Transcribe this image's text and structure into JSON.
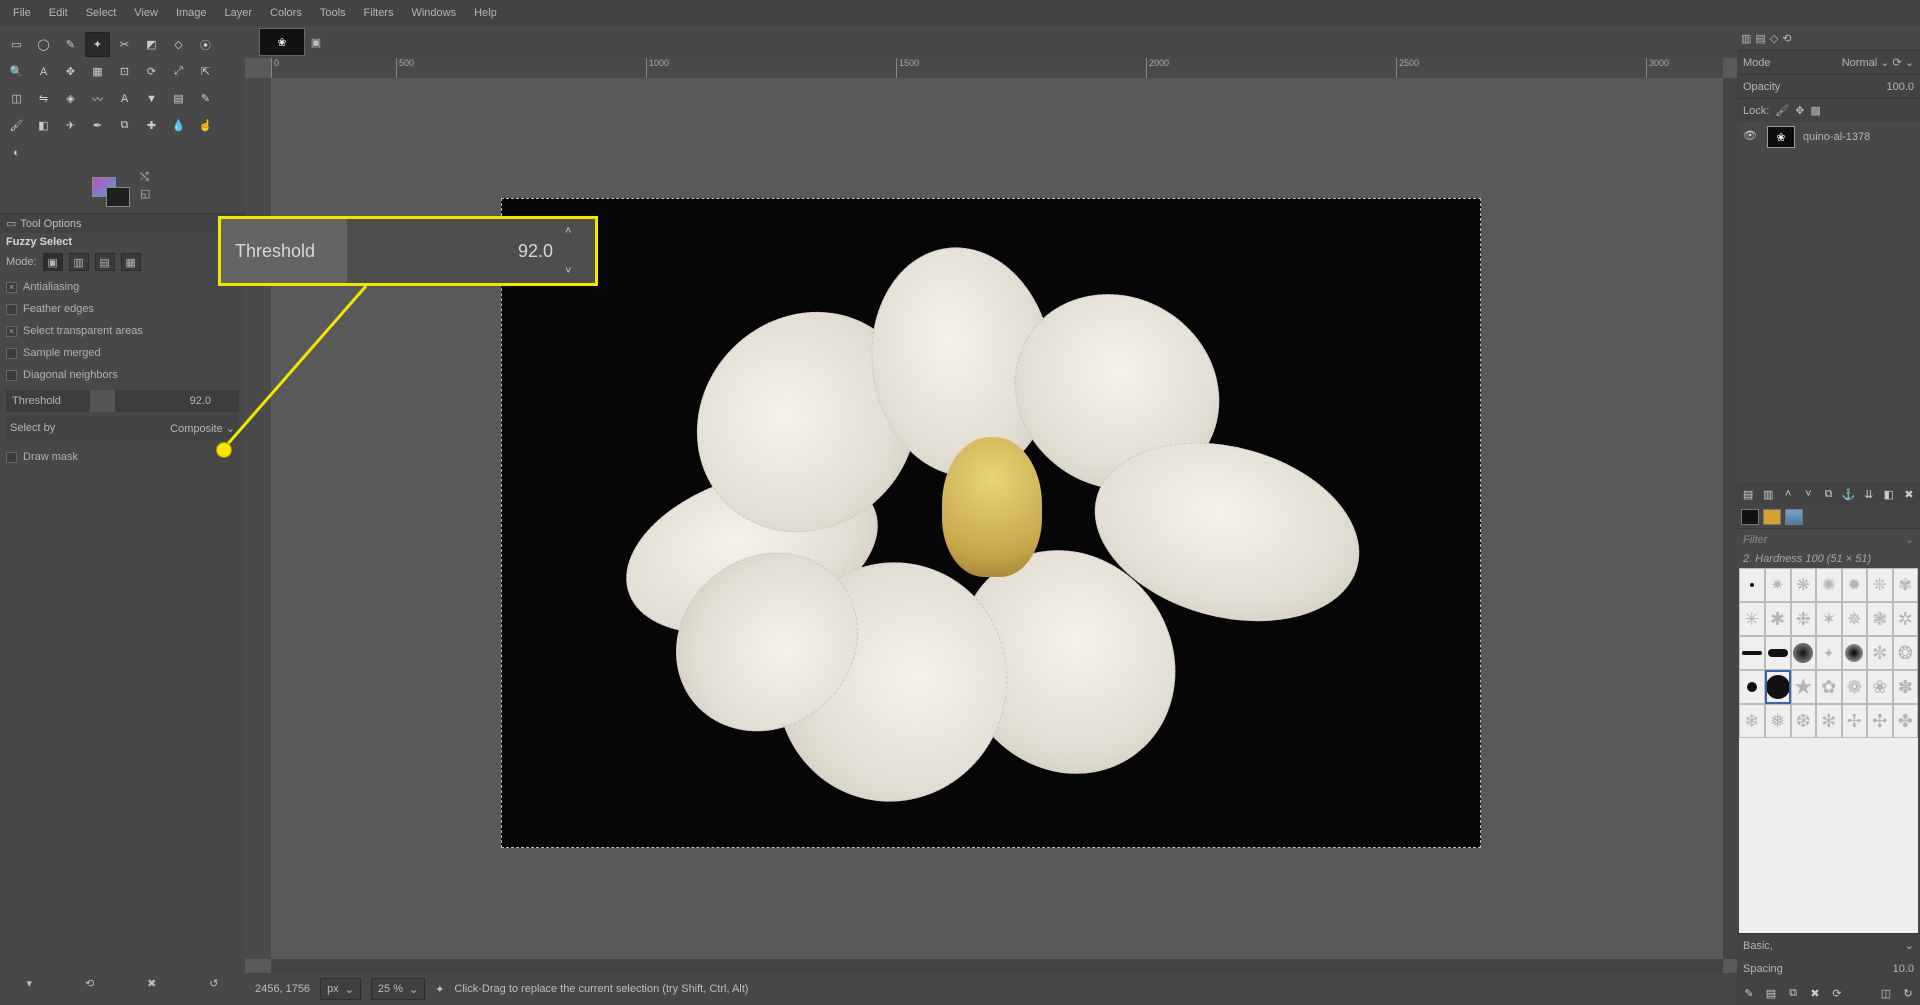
{
  "menubar": [
    "File",
    "Edit",
    "Select",
    "View",
    "Image",
    "Layer",
    "Colors",
    "Tools",
    "Filters",
    "Windows",
    "Help"
  ],
  "toolbox": {
    "title": "Tool Options",
    "tool_name": "Fuzzy Select",
    "mode_label": "Mode:",
    "options": {
      "antialiasing": {
        "label": "Antialiasing",
        "checked": true
      },
      "feather": {
        "label": "Feather edges",
        "checked": false
      },
      "transparent": {
        "label": "Select transparent areas",
        "checked": true
      },
      "sample_merged": {
        "label": "Sample merged",
        "checked": false
      },
      "diagonal": {
        "label": "Diagonal neighbors",
        "checked": false
      },
      "draw_mask": {
        "label": "Draw mask",
        "checked": false
      }
    },
    "threshold": {
      "label": "Threshold",
      "value": "92.0"
    },
    "select_by": {
      "label": "Select by",
      "value": "Composite"
    }
  },
  "callout": {
    "label": "Threshold",
    "value": "92.0"
  },
  "ruler_ticks": [
    "0",
    "500",
    "1000",
    "1500",
    "2000",
    "2500",
    "3000"
  ],
  "status": {
    "coords": "2456, 1756",
    "unit": "px",
    "zoom": "25 %",
    "hint": "Click-Drag to replace the current selection (try Shift, Ctrl, Alt)"
  },
  "layers": {
    "mode_label": "Mode",
    "mode_value": "Normal",
    "opacity_label": "Opacity",
    "opacity_value": "100.0",
    "lock_label": "Lock:",
    "layer_name": "quino-al-1378"
  },
  "brushes": {
    "filter_placeholder": "Filter",
    "selected_label": "2. Hardness 100 (51 × 51)",
    "preset_label": "Basic,",
    "spacing_label": "Spacing",
    "spacing_value": "10.0"
  }
}
